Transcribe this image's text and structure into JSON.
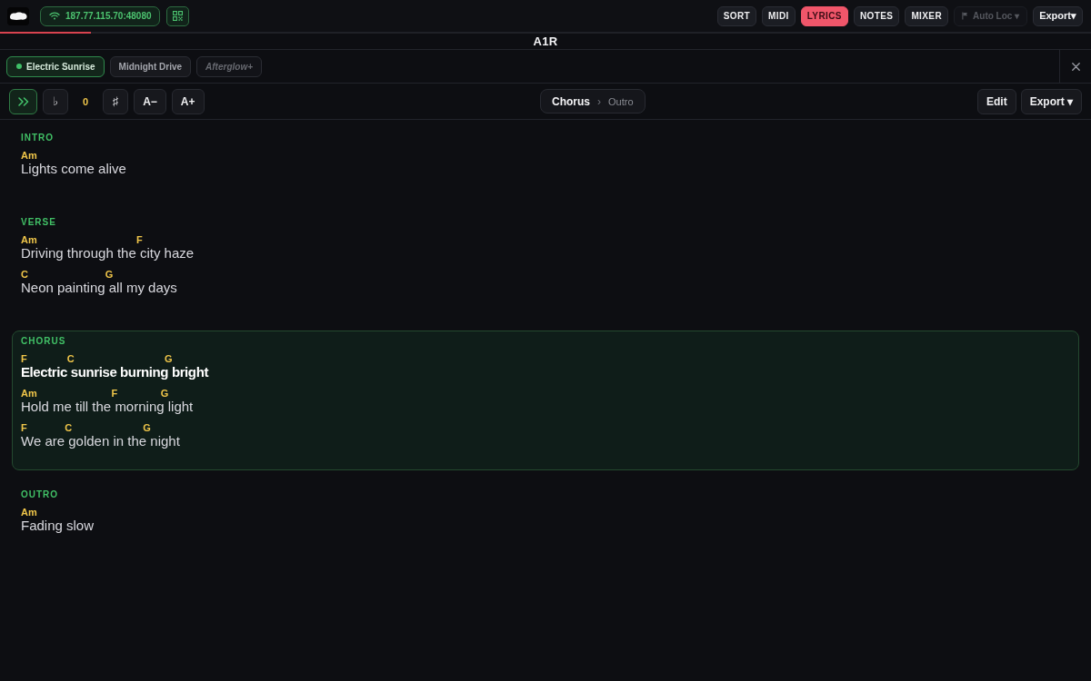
{
  "topbar": {
    "address": "187.77.115.70:48080",
    "views": [
      {
        "label": "SORT",
        "selected": false
      },
      {
        "label": "MIDI",
        "selected": false
      },
      {
        "label": "LYRICS",
        "selected": true
      },
      {
        "label": "NOTES",
        "selected": false
      },
      {
        "label": "MIXER",
        "selected": false
      }
    ],
    "auto_loc": {
      "label": "Auto Loc ▾",
      "disabled": true
    },
    "export": "Export▾"
  },
  "progress": {
    "level": 0.083
  },
  "title": "A1R",
  "tabs": [
    {
      "label": "Electric Sunrise",
      "selected": true,
      "queued": false
    },
    {
      "label": "Midnight Drive",
      "selected": false,
      "queued": false
    },
    {
      "label": "Afterglow+",
      "selected": false,
      "queued": true
    }
  ],
  "toolbar": {
    "flat": "♭",
    "transpose": "0",
    "sharp": "♯",
    "smaller": "A−",
    "larger": "A+",
    "breadcrumb": {
      "current": "Chorus",
      "separator": "›",
      "next": "Outro"
    },
    "edit": "Edit",
    "export": "Export ▾"
  },
  "sections": [
    {
      "label": "INTRO",
      "active": false,
      "lines": [
        {
          "active": false,
          "segments": [
            {
              "chord": "Am",
              "text": "Lights come alive"
            }
          ]
        }
      ]
    },
    {
      "label": "VERSE",
      "active": false,
      "lines": [
        {
          "active": false,
          "segments": [
            {
              "chord": "Am",
              "text": "Driving through the "
            },
            {
              "chord": "F",
              "text": "city haze"
            }
          ]
        },
        {
          "active": false,
          "segments": [
            {
              "chord": "C",
              "text": "Neon painting "
            },
            {
              "chord": "G",
              "text": "all my days"
            }
          ]
        }
      ]
    },
    {
      "label": "CHORUS",
      "active": true,
      "lines": [
        {
          "active": true,
          "segments": [
            {
              "chord": "F",
              "text": "Electric "
            },
            {
              "chord": "C",
              "text": "sunrise burning "
            },
            {
              "chord": "G",
              "text": "bright"
            }
          ]
        },
        {
          "active": false,
          "segments": [
            {
              "chord": "Am",
              "text": "Hold me till the "
            },
            {
              "chord": "F",
              "text": "morning "
            },
            {
              "chord": "G",
              "text": "light"
            }
          ]
        },
        {
          "active": false,
          "segments": [
            {
              "chord": "F",
              "text": "We are "
            },
            {
              "chord": "C",
              "text": "golden in the "
            },
            {
              "chord": "G",
              "text": "night"
            }
          ]
        }
      ]
    },
    {
      "label": "OUTRO",
      "active": false,
      "lines": [
        {
          "active": false,
          "segments": [
            {
              "chord": "Am",
              "text": "Fading slow"
            }
          ]
        }
      ]
    }
  ]
}
